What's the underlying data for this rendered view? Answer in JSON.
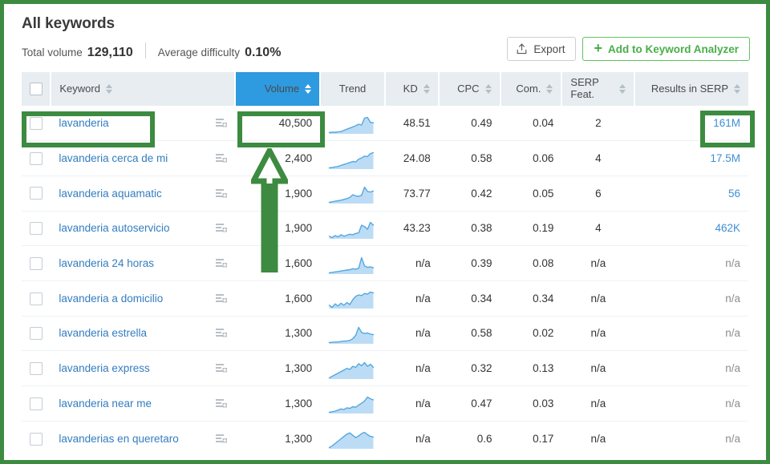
{
  "header": {
    "title": "All keywords",
    "total_volume_label": "Total volume",
    "total_volume_value": "129,110",
    "avg_difficulty_label": "Average difficulty",
    "avg_difficulty_value": "0.10%",
    "export_label": "Export",
    "add_label": "Add to Keyword Analyzer"
  },
  "columns": {
    "keyword": "Keyword",
    "volume": "Volume",
    "trend": "Trend",
    "kd": "KD",
    "cpc": "CPC",
    "com": "Com.",
    "serp_line1": "SERP",
    "serp_line2": "Feat.",
    "results": "Results in SERP"
  },
  "rows": [
    {
      "keyword": "lavanderia",
      "volume": "40,500",
      "kd": "48.51",
      "cpc": "0.49",
      "com": "0.04",
      "serp": "2",
      "results": "161M",
      "results_link": true,
      "trend": [
        30,
        31,
        31,
        32,
        33,
        36,
        39,
        42,
        45,
        48,
        52,
        50,
        68,
        70,
        57,
        56
      ]
    },
    {
      "keyword": "lavanderia cerca de mi",
      "volume": "2,400",
      "kd": "24.08",
      "cpc": "0.58",
      "com": "0.06",
      "serp": "4",
      "results": "17.5M",
      "results_link": true,
      "trend": [
        12,
        14,
        16,
        18,
        22,
        26,
        30,
        34,
        38,
        36,
        48,
        52,
        60,
        58,
        70,
        74
      ]
    },
    {
      "keyword": "lavanderia aquamatic",
      "volume": "1,900",
      "kd": "73.77",
      "cpc": "0.42",
      "com": "0.05",
      "serp": "6",
      "results": "56",
      "results_link": true,
      "trend": [
        22,
        24,
        26,
        28,
        30,
        33,
        36,
        40,
        50,
        46,
        44,
        48,
        78,
        62,
        60,
        64
      ]
    },
    {
      "keyword": "lavanderia autoservicio",
      "volume": "1,900",
      "kd": "43.23",
      "cpc": "0.38",
      "com": "0.19",
      "serp": "4",
      "results": "462K",
      "results_link": true,
      "trend": [
        30,
        26,
        32,
        28,
        34,
        30,
        33,
        36,
        34,
        38,
        40,
        62,
        58,
        50,
        70,
        62
      ]
    },
    {
      "keyword": "lavanderia 24 horas",
      "volume": "1,600",
      "kd": "n/a",
      "cpc": "0.39",
      "com": "0.08",
      "serp": "n/a",
      "results": "n/a",
      "results_link": false,
      "trend": [
        18,
        20,
        22,
        24,
        26,
        28,
        30,
        32,
        36,
        34,
        38,
        84,
        48,
        42,
        44,
        40
      ]
    },
    {
      "keyword": "lavanderia a domicilio",
      "volume": "1,600",
      "kd": "n/a",
      "cpc": "0.34",
      "com": "0.34",
      "serp": "n/a",
      "results": "n/a",
      "results_link": false,
      "trend": [
        30,
        24,
        34,
        28,
        36,
        30,
        38,
        32,
        46,
        56,
        60,
        58,
        64,
        62,
        68,
        66
      ]
    },
    {
      "keyword": "lavanderia estrella",
      "volume": "1,300",
      "kd": "n/a",
      "cpc": "0.58",
      "com": "0.02",
      "serp": "n/a",
      "results": "n/a",
      "results_link": false,
      "trend": [
        26,
        27,
        28,
        28,
        30,
        31,
        32,
        34,
        40,
        52,
        80,
        62,
        58,
        60,
        56,
        54
      ]
    },
    {
      "keyword": "lavanderia express",
      "volume": "1,300",
      "kd": "n/a",
      "cpc": "0.32",
      "com": "0.13",
      "serp": "n/a",
      "results": "n/a",
      "results_link": false,
      "trend": [
        18,
        24,
        30,
        36,
        42,
        48,
        54,
        50,
        62,
        58,
        72,
        64,
        76,
        62,
        70,
        58
      ]
    },
    {
      "keyword": "lavanderia near me",
      "volume": "1,300",
      "kd": "n/a",
      "cpc": "0.47",
      "com": "0.03",
      "serp": "n/a",
      "results": "n/a",
      "results_link": false,
      "trend": [
        22,
        24,
        26,
        30,
        34,
        32,
        38,
        36,
        42,
        40,
        48,
        54,
        62,
        76,
        70,
        66
      ]
    },
    {
      "keyword": "lavanderias en queretaro",
      "volume": "1,300",
      "kd": "n/a",
      "cpc": "0.6",
      "com": "0.17",
      "serp": "n/a",
      "results": "n/a",
      "results_link": false,
      "trend": [
        20,
        26,
        34,
        42,
        50,
        58,
        66,
        70,
        62,
        54,
        60,
        68,
        72,
        64,
        58,
        56
      ]
    }
  ],
  "annotations": {
    "highlight_color": "#3d8b40",
    "boxes": [
      "keyword-cell-lavanderia",
      "volume-cell-40500",
      "results-cell-161M"
    ],
    "arrow": "up-arrow-pointing-at-volume-column"
  },
  "colors": {
    "accent_blue": "#2e9ae0",
    "link_blue": "#337dc0",
    "green": "#3d8b40",
    "header_bg": "#e7edf1"
  }
}
